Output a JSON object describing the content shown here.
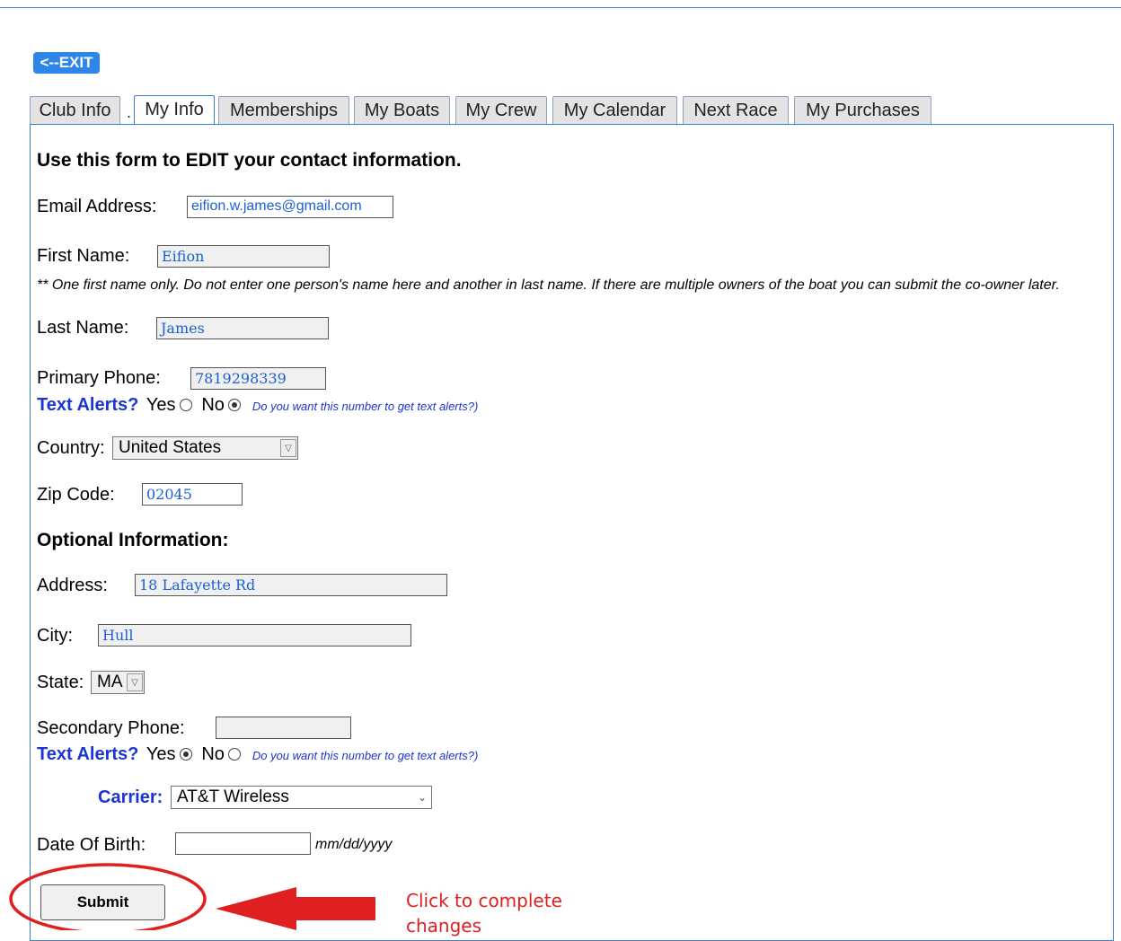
{
  "exit_label": "<--EXIT",
  "tabs": [
    {
      "label": "Club Info",
      "active": false
    },
    {
      "label": "My Info",
      "active": true
    },
    {
      "label": "Memberships",
      "active": false
    },
    {
      "label": "My Boats",
      "active": false
    },
    {
      "label": "My Crew",
      "active": false
    },
    {
      "label": "My Calendar",
      "active": false
    },
    {
      "label": "Next Race",
      "active": false
    },
    {
      "label": "My Purchases",
      "active": false
    }
  ],
  "tab_separator": ".",
  "form": {
    "heading": "Use this form to EDIT your contact information.",
    "email_label": "Email Address:",
    "email_value": "eifion.w.james@gmail.com",
    "first_name_label": "First Name:",
    "first_name_value": "Eifion",
    "first_name_note": "** One first name only. Do not enter one person's name here and another in last name. If there are multiple owners of the boat you can submit the co-owner later.",
    "last_name_label": "Last Name:",
    "last_name_value": "James",
    "primary_phone_label": "Primary Phone:",
    "primary_phone_value": "7819298339",
    "text_alerts_label": "Text Alerts?",
    "yes_label": "Yes",
    "no_label": "No",
    "text_alerts_note": "Do you want this number to get text alerts?)",
    "primary_text_alerts": "No",
    "country_label": "Country:",
    "country_value": "United States",
    "zip_label": "Zip Code:",
    "zip_value": "02045",
    "optional_heading": "Optional Information:",
    "address_label": "Address:",
    "address_value": "18 Lafayette Rd",
    "city_label": "City:",
    "city_value": "Hull",
    "state_label": "State:",
    "state_value": "MA",
    "secondary_phone_label": "Secondary Phone:",
    "secondary_phone_value": "",
    "secondary_text_alerts": "Yes",
    "carrier_label": "Carrier:",
    "carrier_value": "AT&T Wireless",
    "dob_label": "Date Of Birth:",
    "dob_value": "",
    "dob_hint": "mm/dd/yyyy",
    "submit_label": "Submit"
  },
  "annotation": {
    "callout_line1": "Click to complete",
    "callout_line2": "changes",
    "color": "#e02020"
  },
  "colors": {
    "accent": "#3b7fd6",
    "exit_button": "#2e86e8",
    "alert_label": "#1a34d6",
    "input_text": "#1a5fd6"
  }
}
